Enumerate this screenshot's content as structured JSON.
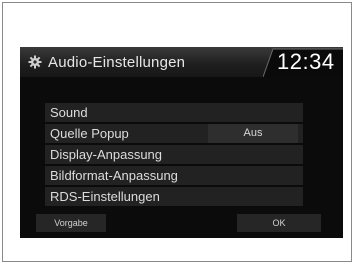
{
  "header": {
    "title": "Audio-Einstellungen",
    "clock": "12:34"
  },
  "menu": {
    "items": [
      {
        "label": "Sound"
      },
      {
        "label": "Quelle Popup",
        "value": "Aus"
      },
      {
        "label": "Display-Anpassung"
      },
      {
        "label": "Bildformat-Anpassung"
      },
      {
        "label": "RDS-Einstellungen"
      }
    ]
  },
  "buttons": {
    "default_label": "Vorgabe",
    "ok_label": "OK"
  },
  "icons": {
    "title_icon": "gear-icon"
  }
}
